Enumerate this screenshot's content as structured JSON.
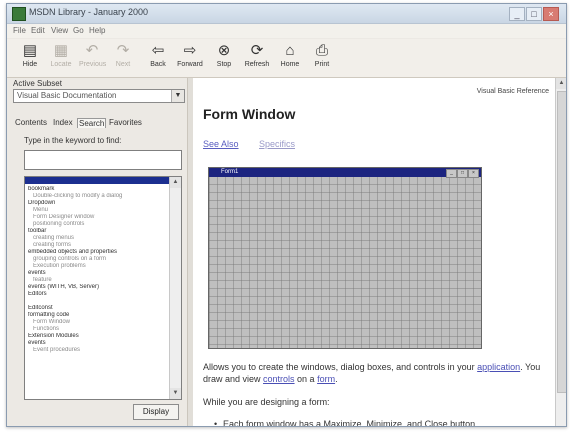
{
  "window": {
    "title": "MSDN Library - January 2000",
    "controls": {
      "minimize": "_",
      "maximize": "□",
      "close": "×"
    }
  },
  "menu": {
    "items": [
      "File",
      "Edit",
      "View",
      "Go",
      "Help"
    ]
  },
  "toolbar": {
    "buttons": [
      {
        "label": "Hide",
        "icon": "hide-icon"
      },
      {
        "label": "Locate",
        "icon": "locate-icon"
      },
      {
        "label": "Previous",
        "icon": "previous-icon"
      },
      {
        "label": "Next",
        "icon": "next-icon"
      },
      {
        "label": "Back",
        "icon": "back-icon"
      },
      {
        "label": "Forward",
        "icon": "forward-icon"
      },
      {
        "label": "Stop",
        "icon": "stop-icon"
      },
      {
        "label": "Refresh",
        "icon": "refresh-icon"
      },
      {
        "label": "Home",
        "icon": "home-icon"
      },
      {
        "label": "Print",
        "icon": "print-icon"
      }
    ]
  },
  "left": {
    "active_subset_label": "Active Subset",
    "active_subset_value": "Visual Basic Documentation",
    "tabs": [
      "Contents",
      "Index",
      "Search",
      "Favorites"
    ],
    "keyword_prompt": "Type in the keyword to find:",
    "keyword_value": "",
    "index_entries": [
      {
        "text": "bookmark",
        "level": 1
      },
      {
        "text": "Double-clicking to modify a dialog",
        "level": 2
      },
      {
        "text": "Dropdown",
        "level": 1
      },
      {
        "text": "Menu",
        "level": 2
      },
      {
        "text": "Form Designer window",
        "level": 2
      },
      {
        "text": "positioning controls",
        "level": 2
      },
      {
        "text": "toolbar",
        "level": 1
      },
      {
        "text": "creating menus",
        "level": 2
      },
      {
        "text": "creating forms",
        "level": 2
      },
      {
        "text": "embedded objects and properties",
        "level": 1
      },
      {
        "text": "grouping controls on a form",
        "level": 2
      },
      {
        "text": "Execution problems",
        "level": 2
      },
      {
        "text": "events",
        "level": 1
      },
      {
        "text": "feature",
        "level": 2
      },
      {
        "text": "events (WITH, VB, Server)",
        "level": 1
      },
      {
        "text": "Editors",
        "level": 1
      },
      {
        "text": "",
        "level": 1
      },
      {
        "text": "Editconst",
        "level": 1
      },
      {
        "text": "formatting code",
        "level": 1
      },
      {
        "text": "Form Window",
        "level": 2
      },
      {
        "text": "Functions",
        "level": 2
      },
      {
        "text": "Extension Modules",
        "level": 1
      },
      {
        "text": "events",
        "level": 1
      },
      {
        "text": "Event procedures",
        "level": 2
      }
    ],
    "display_button": "Display"
  },
  "topic": {
    "header": "Visual Basic Reference",
    "title": "Form Window",
    "see_also": "See Also",
    "specifics": "Specifics",
    "form_caption": "Form1",
    "form_controls": [
      "_",
      "□",
      "×"
    ],
    "para1": {
      "t1": "Allows you to create the windows, dialog boxes, and controls in your ",
      "link1": "application",
      "t2": ". You draw and view ",
      "link2": "controls",
      "t3": " on a ",
      "link3": "form",
      "t4": "."
    },
    "para2": "While you are designing a form:",
    "bullet1": "Each form window has a Maximize, Minimize, and Close button."
  }
}
